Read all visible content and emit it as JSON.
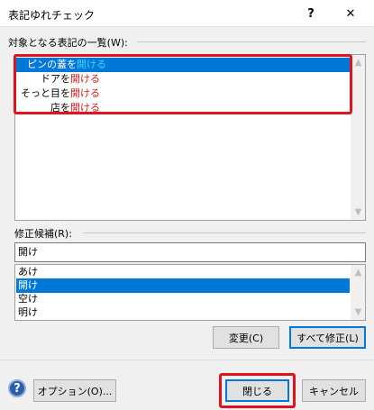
{
  "window": {
    "title": "表記ゆれチェック",
    "help_glyph": "?",
    "close_glyph": "✕"
  },
  "targets": {
    "label": "対象となる表記の一覧(W):",
    "items": [
      {
        "before": "ピンの蓋を",
        "match": "開ける",
        "after": ""
      },
      {
        "before": "ドアを",
        "match": "開ける",
        "after": ""
      },
      {
        "before": "そっと目を",
        "match": "開ける",
        "after": ""
      },
      {
        "before": "店を",
        "match": "開ける",
        "after": ""
      }
    ]
  },
  "candidates": {
    "label": "修正候補(R):",
    "current_value": "開け",
    "items": [
      "あけ",
      "開け",
      "空け",
      "明け"
    ],
    "selected_index": 1
  },
  "buttons": {
    "change": "変更(C)",
    "fix_all": "すべて修正(L)",
    "options": "オプション(O)...",
    "close": "閉じる",
    "cancel": "キャンセル"
  },
  "colors": {
    "selection": "#0078d7",
    "highlight": "#d31c1c",
    "highlight_on_selection": "#3fd2ff",
    "annotation_box": "#e0141e"
  }
}
